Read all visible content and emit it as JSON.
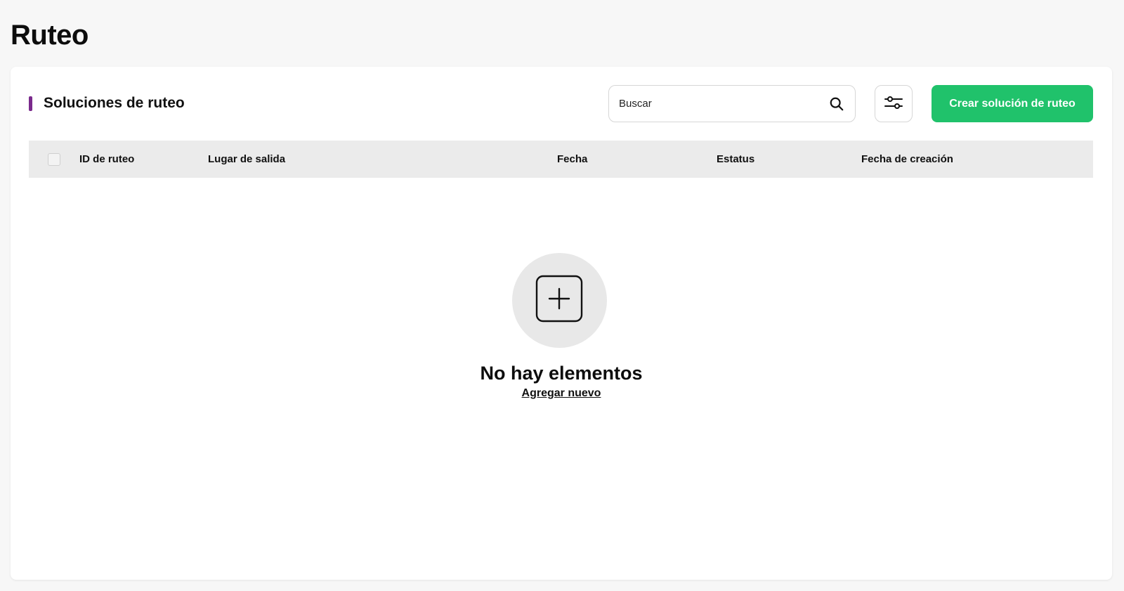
{
  "page": {
    "title": "Ruteo"
  },
  "section": {
    "title": "Soluciones de ruteo",
    "accent_color": "#7a2a8c"
  },
  "search": {
    "placeholder": "Buscar",
    "value": "",
    "icon": "search-icon"
  },
  "filter": {
    "icon": "sliders-icon"
  },
  "create_button": {
    "label": "Crear solución de ruteo",
    "color": "#20c26b"
  },
  "table": {
    "columns": [
      "ID de ruteo",
      "Lugar de salida",
      "Fecha",
      "Estatus",
      "Fecha de creación"
    ],
    "rows": []
  },
  "empty_state": {
    "icon": "add-square-icon",
    "title": "No hay elementos",
    "link": "Agregar nuevo"
  }
}
